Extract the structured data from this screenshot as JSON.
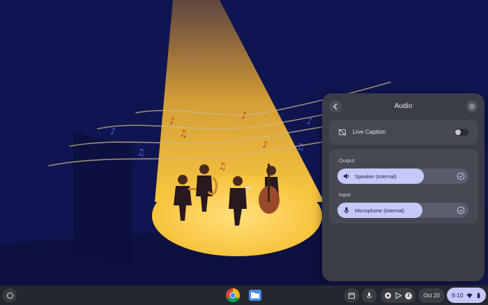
{
  "audio_panel": {
    "title": "Audio",
    "live_caption": {
      "label": "Live Caption",
      "enabled": false
    },
    "output": {
      "section_label": "Output",
      "device_label": "Speaker (internal)",
      "volume_fraction": 0.66,
      "selected": true
    },
    "input": {
      "section_label": "Input",
      "device_label": "Microphone (internal)",
      "gain_fraction": 0.65,
      "selected": true
    }
  },
  "shelf": {
    "apps": [
      "chrome-icon",
      "files-icon"
    ],
    "notification_count": "2",
    "date": "Oct 20",
    "time": "9:10"
  },
  "colors": {
    "wallpaper_bg": "#0f1550",
    "spotlight": "#f5b731",
    "panel_bg": "#3a3d47",
    "card_bg": "#464953",
    "accent": "#c6c9f7",
    "shelf_bg": "#25272e"
  }
}
